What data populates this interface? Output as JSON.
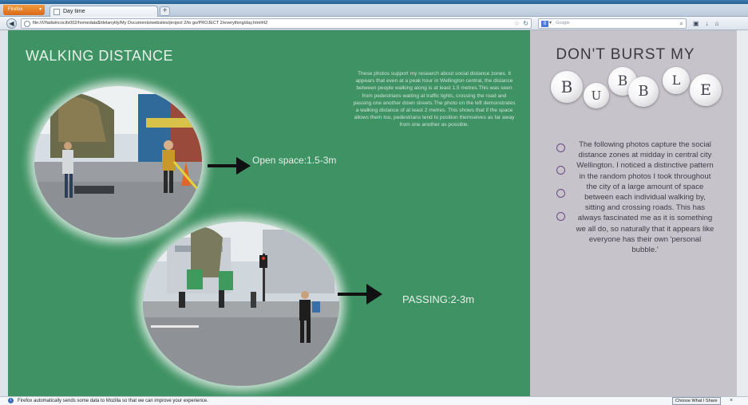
{
  "browser": {
    "menu_button": "Firefox",
    "tab_title": "Day time",
    "new_tab": "+",
    "url": "file://///fadwincocifs002/homedata$/delanylily/My Documents/websites/project 2/to go/PROJECT 2/everything/day.html#t2",
    "search_placeholder": "Google",
    "search_engine": "8"
  },
  "left_panel": {
    "heading": "WALKING DISTANCE",
    "label_open": "Open space:1.5-3m",
    "label_passing": "PASSING:2-3m",
    "paragraph": "These photos support my research about social distance zones. It appears that even at a peak hour in Wellington central, the distance between people walking along is at least 1.5 metres.This was seen from pedestrians waiting at traffic lights, crossing the road and passing one another down streets.The photo on the left demonstrates a walking distance of at least 2 metres. This shows that if the space allows them too, pedestrians tend to position themselves as far away from one another as possible."
  },
  "right_panel": {
    "title": "DON'T BURST MY",
    "bubble_letters": [
      "B",
      "U",
      "B",
      "B",
      "L",
      "E"
    ],
    "paragraph": "The following photos capture the social distance zones at midday in central city Wellington. I noticed a distinctive pattern in the random photos I took throughout the city of a large amount of space between each individual walking by, sitting and crossing roads. This has always fascinated me as it is something we all do, so naturally that it appears like everyone has their own 'personal bubble.'"
  },
  "notification": {
    "message": "Firefox automatically sends some data to Mozilla so that we can improve your experience.",
    "button": "Choose What I Share",
    "close": "×"
  },
  "colors": {
    "page_green": "#3e9263",
    "right_panel_grey": "#c6c4ca",
    "bullet_purple": "#6a4a86"
  }
}
